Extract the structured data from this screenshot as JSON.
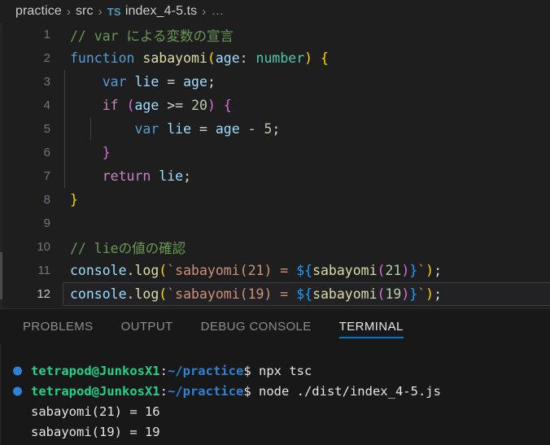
{
  "breadcrumb": {
    "items": [
      "practice",
      "src"
    ],
    "separator": "›",
    "file_icon_label": "TS",
    "file_name": "index_4-5.ts",
    "trailing": "…"
  },
  "editor": {
    "language": "TypeScript",
    "active_line": 12,
    "lines": [
      {
        "num": "1",
        "text": "// var による変数の宣言"
      },
      {
        "num": "2",
        "text": "function sabayomi(age: number) {"
      },
      {
        "num": "3",
        "text": "    var lie = age;"
      },
      {
        "num": "4",
        "text": "    if (age >= 20) {"
      },
      {
        "num": "5",
        "text": "        var lie = age - 5;"
      },
      {
        "num": "6",
        "text": "    }"
      },
      {
        "num": "7",
        "text": "    return lie;"
      },
      {
        "num": "8",
        "text": "}"
      },
      {
        "num": "9",
        "text": ""
      },
      {
        "num": "10",
        "text": "// lieの値の確認"
      },
      {
        "num": "11",
        "text": "console.log(`sabayomi(21) = ${sabayomi(21)}`);"
      },
      {
        "num": "12",
        "text": "console.log(`sabayomi(19) = ${sabayomi(19)}`);"
      }
    ],
    "tokens": {
      "l1_comment": "// var による変数の宣言",
      "l2_kw": "function",
      "l2_sp1": " ",
      "l2_fn": "sabayomi",
      "l2_paren_open": "(",
      "l2_param": "age",
      "l2_colon": ": ",
      "l2_type": "number",
      "l2_paren_close": ")",
      "l2_sp2": " ",
      "l2_brace": "{",
      "l3_kw": "var",
      "l3_name": "lie",
      "l3_eq": "=",
      "l3_val": "age",
      "l3_semi": ";",
      "l4_kw": "if",
      "l4_paren_open": "(",
      "l4_var": "age",
      "l4_op": ">=",
      "l4_num": "20",
      "l4_paren_close": ")",
      "l4_brace": "{",
      "l5_kw": "var",
      "l5_name": "lie",
      "l5_eq": "=",
      "l5_val": "age",
      "l5_minus": "-",
      "l5_num": "5",
      "l5_semi": ";",
      "l6_brace": "}",
      "l7_kw": "return",
      "l7_var": "lie",
      "l7_semi": ";",
      "l8_brace": "}",
      "l10_comment": "// lieの値の確認",
      "l11_obj": "console",
      "l11_dot": ".",
      "l11_method": "log",
      "l11_paren_open": "(",
      "l11_str": "`sabayomi(21) = ",
      "l11_tpl_open": "${",
      "l11_fn": "sabayomi",
      "l11_inner_open": "(",
      "l11_arg": "21",
      "l11_inner_close": ")",
      "l11_tpl_close": "}",
      "l11_str_end": "`",
      "l11_paren_close": ")",
      "l11_semi": ";",
      "l12_obj": "console",
      "l12_dot": ".",
      "l12_method": "log",
      "l12_paren_open": "(",
      "l12_str": "`sabayomi(19) = ",
      "l12_tpl_open": "${",
      "l12_fn": "sabayomi",
      "l12_inner_open": "(",
      "l12_arg": "19",
      "l12_inner_close": ")",
      "l12_tpl_close": "}",
      "l12_str_end": "`",
      "l12_paren_close": ")",
      "l12_semi": ";"
    }
  },
  "panel": {
    "tabs": [
      {
        "label": "PROBLEMS",
        "active": false
      },
      {
        "label": "OUTPUT",
        "active": false
      },
      {
        "label": "DEBUG CONSOLE",
        "active": false
      },
      {
        "label": "TERMINAL",
        "active": true
      }
    ],
    "terminal": {
      "prompt_user": "tetrapod@JunkosX1",
      "prompt_colon": ":",
      "prompt_path": "~/practice",
      "prompt_dollar": "$",
      "lines": [
        {
          "type": "command",
          "text": " npx tsc"
        },
        {
          "type": "command",
          "text": " node ./dist/index_4-5.js"
        },
        {
          "type": "output",
          "text": "sabayomi(21) = 16"
        },
        {
          "type": "output",
          "text": "sabayomi(19) = 19"
        }
      ]
    }
  },
  "colors": {
    "editor_bg": "#1e1e1e",
    "panel_bg": "#181818",
    "accent": "#0078d4",
    "terminal_green": "#23d18b",
    "terminal_blue": "#2f80d6"
  }
}
